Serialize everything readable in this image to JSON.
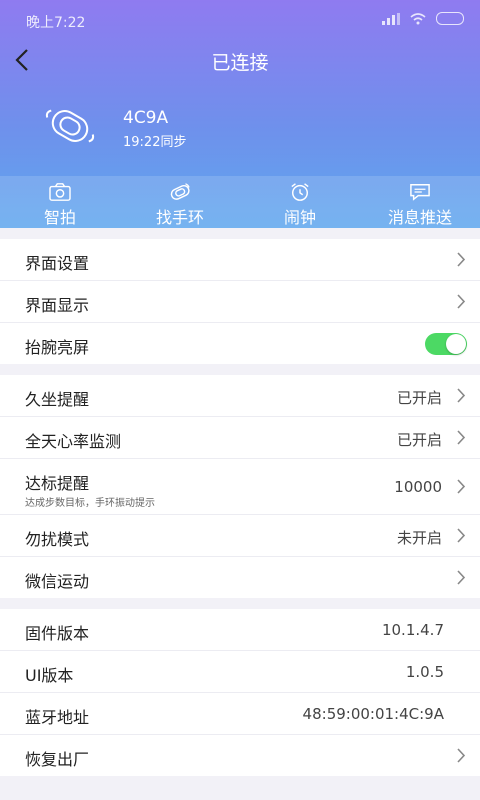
{
  "status_bar": {
    "time": "晚上7:22"
  },
  "header": {
    "title": "已连接"
  },
  "device": {
    "name": "4C9A",
    "sync": "19:22同步"
  },
  "actions": [
    {
      "label": "智拍",
      "icon": "camera-icon"
    },
    {
      "label": "找手环",
      "icon": "find-band-icon"
    },
    {
      "label": "闹钟",
      "icon": "alarm-clock-icon"
    },
    {
      "label": "消息推送",
      "icon": "message-icon"
    }
  ],
  "group1": [
    {
      "label": "界面设置"
    },
    {
      "label": "界面显示"
    },
    {
      "label": "抬腕亮屏",
      "toggle_on": true
    }
  ],
  "group2": [
    {
      "label": "久坐提醒",
      "value": "已开启"
    },
    {
      "label": "全天心率监测",
      "value": "已开启"
    },
    {
      "label": "达标提醒",
      "sub": "达成步数目标，手环振动提示",
      "value": "10000"
    },
    {
      "label": "勿扰模式",
      "value": "未开启"
    },
    {
      "label": "微信运动"
    }
  ],
  "group3": [
    {
      "label": "固件版本",
      "value": "10.1.4.7"
    },
    {
      "label": "UI版本",
      "value": "1.0.5"
    },
    {
      "label": "蓝牙地址",
      "value": "48:59:00:01:4C:9A"
    },
    {
      "label": "恢复出厂"
    }
  ],
  "colors": {
    "toggle_on": "#4cd964",
    "header_top": "#8f7bf0",
    "header_bottom": "#5fa7ee"
  }
}
